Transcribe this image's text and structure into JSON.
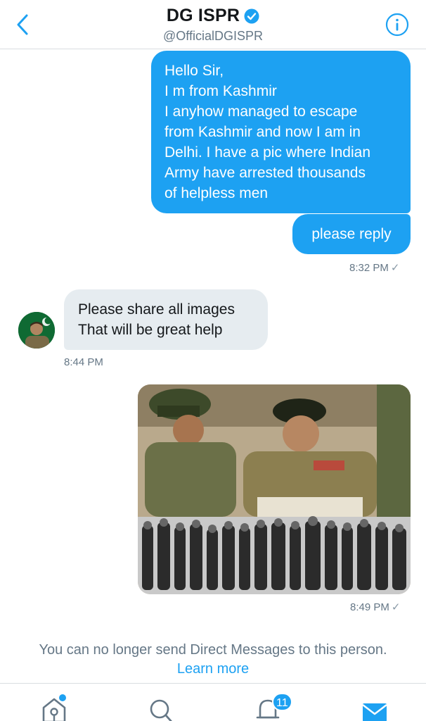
{
  "header": {
    "title": "DG ISPR",
    "handle": "@OfficialDGISPR",
    "back_icon": "chevron-left-icon",
    "info_icon": "info-icon",
    "verified_icon": "verified-badge-icon"
  },
  "messages": [
    {
      "direction": "sent",
      "lines": [
        "Hello Sir,",
        "I m from Kashmir",
        "I anyhow managed to escape",
        "from Kashmir and now I am in",
        "Delhi. I have a pic where Indian",
        "Army have arrested thousands",
        "of helpless men"
      ]
    },
    {
      "direction": "sent",
      "text": "please reply"
    },
    {
      "time": "8:32 PM",
      "read_mark": "✓"
    },
    {
      "direction": "received",
      "lines": [
        "Please share all images",
        "That will be great help"
      ],
      "time": "8:44 PM"
    },
    {
      "direction": "sent",
      "type": "image",
      "time": "8:49 PM",
      "read_mark": "✓"
    }
  ],
  "footer": {
    "blocked_text": "You can no longer send Direct Messages to this person.",
    "learn_more": "Learn more"
  },
  "tabbar": {
    "home_icon": "home-icon",
    "search_icon": "search-icon",
    "notifications_icon": "bell-icon",
    "notifications_badge": "11",
    "messages_icon": "envelope-icon"
  },
  "colors": {
    "accent": "#1da1f2",
    "received_bubble": "#e6ecf0",
    "secondary_text": "#657786"
  }
}
